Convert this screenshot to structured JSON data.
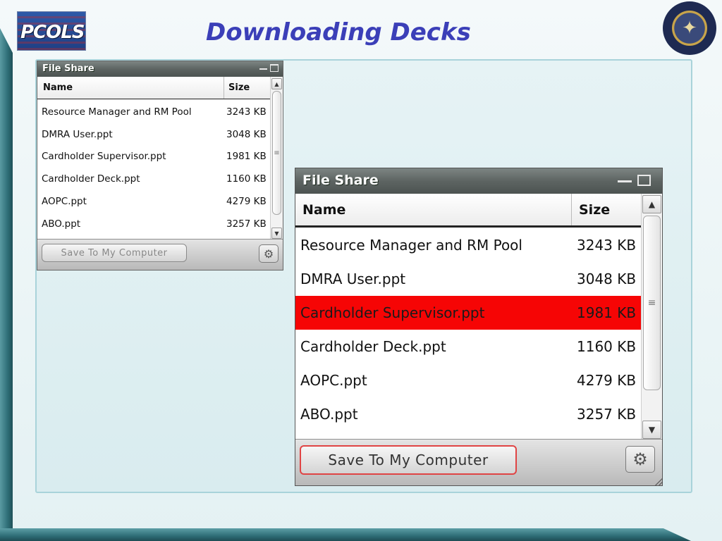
{
  "slide": {
    "title": "Downloading Decks",
    "logo_text": "PCOLS",
    "seal_icon": "department-of-defense-seal-icon"
  },
  "file_share": {
    "window_title": "File Share",
    "columns": {
      "name": "Name",
      "size": "Size"
    },
    "rows": [
      {
        "name": "Resource Manager and RM Pool",
        "size": "3243 KB"
      },
      {
        "name": "DMRA User.ppt",
        "size": "3048 KB"
      },
      {
        "name": "Cardholder Supervisor.ppt",
        "size": "1981 KB"
      },
      {
        "name": "Cardholder Deck.ppt",
        "size": "1160 KB"
      },
      {
        "name": "AOPC.ppt",
        "size": "4279 KB"
      },
      {
        "name": "ABO.ppt",
        "size": "3257 KB"
      }
    ],
    "selected_row_index_large": 2,
    "save_button_label": "Save To My Computer",
    "colors": {
      "selection": "#f60505",
      "title_text": "#3b3fb8",
      "save_button_highlight": "#e04444"
    }
  }
}
